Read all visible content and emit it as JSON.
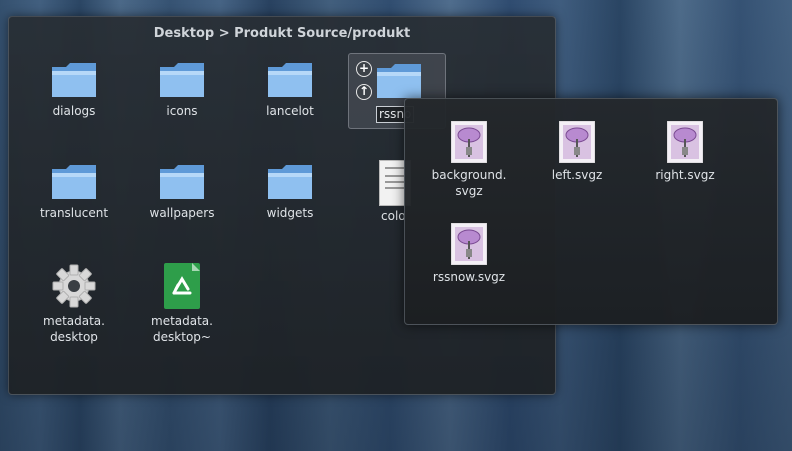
{
  "breadcrumb": "Desktop > Produkt Source/produkt",
  "folders": {
    "dialogs": "dialogs",
    "icons": "icons",
    "lancelot": "lancelot",
    "rssnow": "rssno",
    "translucent": "translucent",
    "wallpapers": "wallpapers",
    "widgets": "widgets",
    "colors": "colo"
  },
  "files": {
    "metadata_desktop": [
      "metadata.",
      "desktop"
    ],
    "metadata_desktop_backup": [
      "metadata.",
      "desktop~"
    ]
  },
  "popup": {
    "items": [
      [
        "background.",
        "svgz"
      ],
      [
        "left.svgz"
      ],
      [
        "right.svgz"
      ],
      [
        "rssnow.svgz"
      ]
    ]
  },
  "hover_buttons": {
    "add": "+",
    "up": "↑"
  },
  "colors": {
    "folder": "#7fb2e8",
    "panel": "#2a2f34",
    "text": "#dfe3e7"
  }
}
